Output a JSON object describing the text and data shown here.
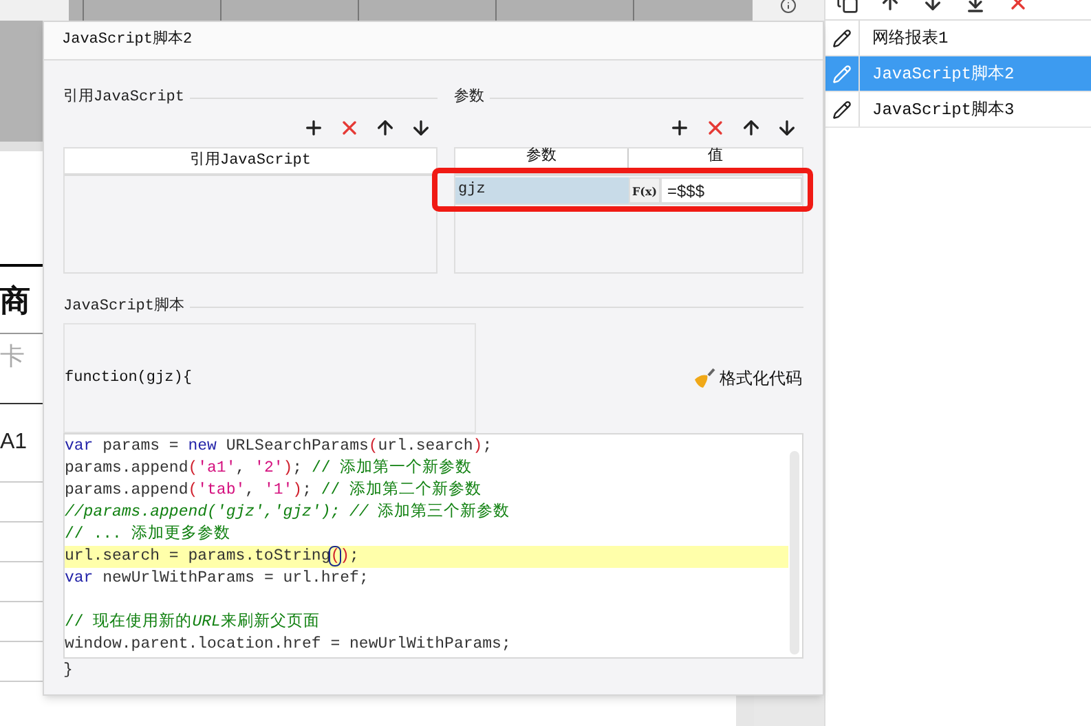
{
  "canvas": {
    "sheet_texts": [
      "商",
      "卡",
      "A1"
    ]
  },
  "dialog": {
    "title": "JavaScript脚本2",
    "js_refs": {
      "legend": "引用JavaScript",
      "column": "引用JavaScript"
    },
    "params": {
      "legend": "参数",
      "columns": [
        "参数",
        "值"
      ],
      "rows": [
        {
          "name": "gjz",
          "formula_button": "F(x)",
          "value": "=$$$",
          "selected": true
        }
      ]
    },
    "script": {
      "legend": "JavaScript脚本",
      "signature": "function(gjz){",
      "format_button": "格式化代码",
      "lines": [
        {
          "highlighted": false,
          "segments": [
            {
              "kind": "keyword",
              "text": "var"
            },
            {
              "kind": "plain",
              "text": " params = "
            },
            {
              "kind": "keyword",
              "text": "new"
            },
            {
              "kind": "plain",
              "text": " URLSearchParams"
            },
            {
              "kind": "bracket",
              "text": "("
            },
            {
              "kind": "plain",
              "text": "url.search"
            },
            {
              "kind": "bracket",
              "text": ")"
            },
            {
              "kind": "plain",
              "text": ";"
            }
          ]
        },
        {
          "highlighted": false,
          "segments": [
            {
              "kind": "plain",
              "text": "params.append"
            },
            {
              "kind": "bracket",
              "text": "("
            },
            {
              "kind": "string",
              "text": "'a1'"
            },
            {
              "kind": "plain",
              "text": ", "
            },
            {
              "kind": "string",
              "text": "'2'"
            },
            {
              "kind": "bracket",
              "text": ")"
            },
            {
              "kind": "plain",
              "text": "; "
            },
            {
              "kind": "comment",
              "text": "// 添加第一个新参数"
            }
          ]
        },
        {
          "highlighted": false,
          "segments": [
            {
              "kind": "plain",
              "text": "params.append"
            },
            {
              "kind": "bracket",
              "text": "("
            },
            {
              "kind": "string",
              "text": "'tab'"
            },
            {
              "kind": "plain",
              "text": ", "
            },
            {
              "kind": "string",
              "text": "'1'"
            },
            {
              "kind": "bracket",
              "text": ")"
            },
            {
              "kind": "plain",
              "text": "; "
            },
            {
              "kind": "comment",
              "text": "// 添加第二个新参数"
            }
          ]
        },
        {
          "highlighted": false,
          "segments": [
            {
              "kind": "comment_italic",
              "text": "//params.append('gjz','gjz'); //"
            },
            {
              "kind": "comment",
              "text": " 添加第三个新参数"
            }
          ]
        },
        {
          "highlighted": false,
          "segments": [
            {
              "kind": "comment",
              "text": "// ... 添加更多参数"
            }
          ]
        },
        {
          "highlighted": true,
          "segments": [
            {
              "kind": "plain",
              "text": "url.search = params.toString"
            },
            {
              "kind": "matched_bracket",
              "text": "("
            },
            {
              "kind": "bracket",
              "text": ")"
            },
            {
              "kind": "plain",
              "text": ";"
            }
          ]
        },
        {
          "highlighted": false,
          "segments": [
            {
              "kind": "keyword",
              "text": "var"
            },
            {
              "kind": "plain",
              "text": " newUrlWithParams = url.href;"
            }
          ]
        },
        {
          "highlighted": false
        },
        {
          "highlighted": false,
          "segments": [
            {
              "kind": "comment",
              "text": "// 现在使用新的"
            },
            {
              "kind": "comment_italic",
              "text": "URL"
            },
            {
              "kind": "comment",
              "text": "来刷新父页面"
            }
          ]
        },
        {
          "highlighted": false,
          "segments": [
            {
              "kind": "plain",
              "text": "window.parent.location.href = newUrlWithParams;"
            }
          ]
        }
      ],
      "closing": "}"
    }
  },
  "side_panel": {
    "items": [
      {
        "label": "网络报表1",
        "selected": false
      },
      {
        "label": "JavaScript脚本2",
        "selected": true
      },
      {
        "label": "JavaScript脚本3",
        "selected": false
      }
    ]
  }
}
